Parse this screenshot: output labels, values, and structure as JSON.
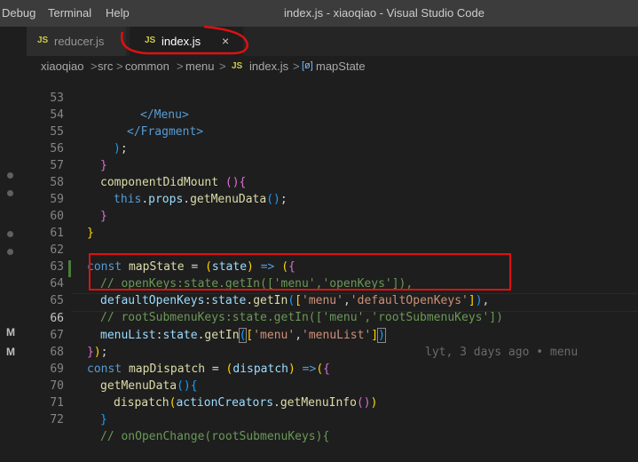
{
  "menubar": {
    "items": [
      "Debug",
      "Terminal",
      "Help"
    ]
  },
  "window_title": "index.js - xiaoqiao - Visual Studio Code",
  "tabs": [
    {
      "icon": "JS",
      "label": "reducer.js",
      "active": false
    },
    {
      "icon": "JS",
      "label": "index.js",
      "active": true,
      "close": "×"
    }
  ],
  "breadcrumb": [
    "xiaoqiao",
    "src",
    "common",
    "menu",
    "index.js",
    "mapState"
  ],
  "breadcrumb_separator": ">",
  "breadcrumb_file_icon": "JS",
  "breadcrumb_symbol_icon": "[ø]",
  "gutter_marks": [
    "M",
    "M"
  ],
  "code_lines": [
    {
      "n": "53",
      "text": "            </Menu>"
    },
    {
      "n": "54",
      "text": "          </Fragment>"
    },
    {
      "n": "55",
      "text": "        );"
    },
    {
      "n": "56",
      "text": "      }"
    },
    {
      "n": "57",
      "text": "      componentDidMount (){"
    },
    {
      "n": "58",
      "text": "        this.props.getMenuData();"
    },
    {
      "n": "59",
      "text": "      }"
    },
    {
      "n": "60",
      "text": "    }"
    },
    {
      "n": "61",
      "text": ""
    },
    {
      "n": "62",
      "text": "    const mapState = (state) => ({"
    },
    {
      "n": "63",
      "text": "      // openKeys:state.getIn(['menu','openKeys']),"
    },
    {
      "n": "64",
      "text": "      defaultOpenKeys:state.getIn(['menu','defaultOpenKeys']),"
    },
    {
      "n": "65",
      "text": "      // rootSubmenuKeys:state.getIn(['menu','rootSubmenuKeys'])"
    },
    {
      "n": "66",
      "text": "      menuList:state.getIn(['menu','menuList'])"
    },
    {
      "n": "67",
      "text": "    });"
    },
    {
      "n": "68",
      "text": "    const mapDispatch = (dispatch) =>({"
    },
    {
      "n": "69",
      "text": "      getMenuData(){"
    },
    {
      "n": "70",
      "text": "        dispatch(actionCreators.getMenuInfo())"
    },
    {
      "n": "71",
      "text": "      }"
    },
    {
      "n": "72",
      "text": "      // onOpenChange(rootSubmenuKeys){"
    }
  ],
  "blame_annotation": "lyt, 3 days ago • menu",
  "colors": {
    "background": "#1e1e1e",
    "titlebar": "#3c3c3c",
    "comment": "#6a9955",
    "keyword": "#569cd6",
    "string": "#ce9178",
    "annotation_box": "#e01010"
  }
}
